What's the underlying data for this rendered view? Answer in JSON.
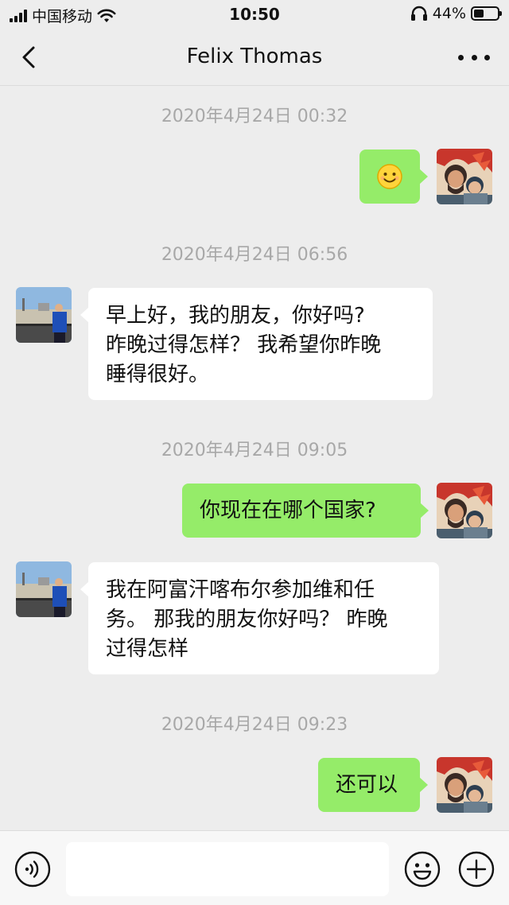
{
  "status_bar": {
    "carrier": "中国移动",
    "time": "10:50",
    "battery": "44%",
    "battery_level": 0.44
  },
  "nav": {
    "title": "Felix Thomas",
    "back_icon": "chevron-left-icon",
    "more_icon": "more-dots-icon"
  },
  "messages": [
    {
      "timestamp": "2020年4月24日 00:32",
      "direction": "sent",
      "content": "",
      "emoji": "smiling-face-emoji"
    },
    {
      "timestamp": "2020年4月24日 06:56",
      "direction": "received",
      "lines": [
        "早上好，我的朋友，你好吗?",
        "昨晚过得怎样？ 我希望你昨晚",
        "睡得很好。"
      ]
    },
    {
      "timestamp": "2020年4月24日 09:05",
      "direction": "sent",
      "content": "你现在在哪个国家?"
    },
    {
      "timestamp": "",
      "direction": "received",
      "lines": [
        "我在阿富汗喀布尔参加维和任",
        "务。 那我的朋友你好吗？ 昨晚",
        "过得怎样"
      ]
    },
    {
      "timestamp": "2020年4月24日 09:23",
      "direction": "sent",
      "content": "还可以"
    }
  ],
  "input_bar": {
    "voice_icon": "voice-icon",
    "emoji_icon": "emoji-icon",
    "add_icon": "plus-icon",
    "input_value": ""
  },
  "colors": {
    "sent_bubble": "#95ec69",
    "received_bubble": "#ffffff",
    "background": "#ededed"
  }
}
